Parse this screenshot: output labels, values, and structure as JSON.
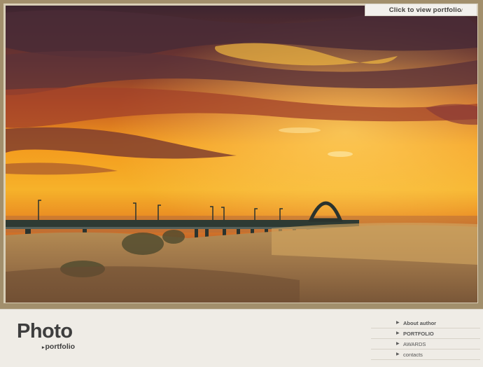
{
  "header": {
    "view_portfolio_label": "Click to view portfolio",
    "view_portfolio_icon": "chevron-down-icon"
  },
  "logo": {
    "title": "Photo",
    "subtitle": "portfolio"
  },
  "nav": {
    "items": [
      {
        "label": "About author",
        "active": true
      },
      {
        "label": "PORTFOLIO",
        "active": true
      },
      {
        "label": "AWARDS",
        "active": false
      },
      {
        "label": "contacts",
        "active": false
      }
    ]
  },
  "colors": {
    "frame": "#a28f6c",
    "background": "#efece6",
    "text": "#3e3e3e"
  }
}
